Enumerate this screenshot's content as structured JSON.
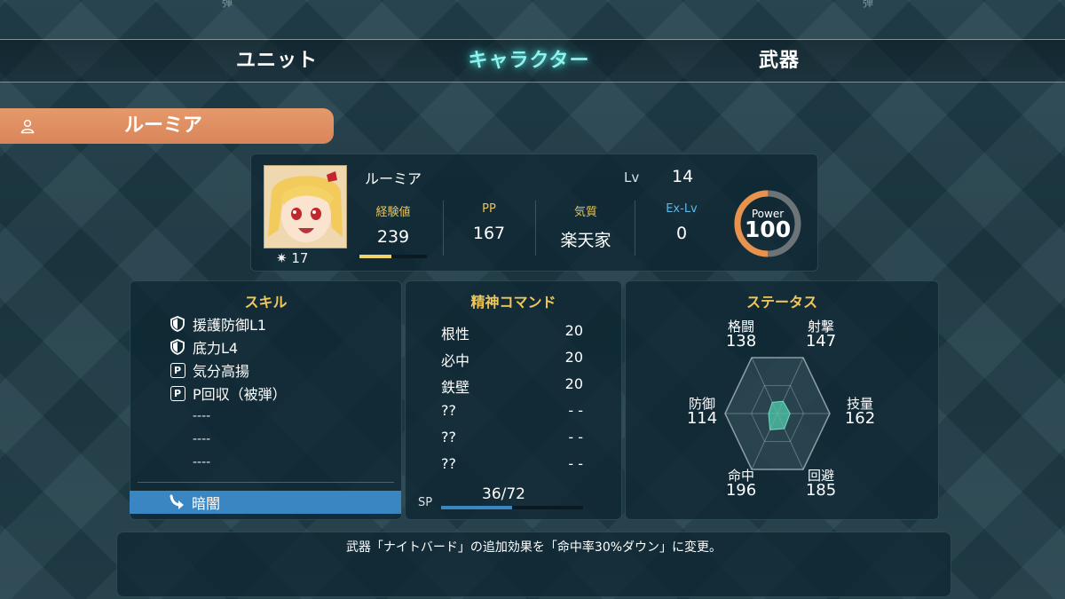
{
  "top_marks": [
    "弾",
    "弾"
  ],
  "tabs": [
    {
      "label": "ユニット",
      "active": false
    },
    {
      "label": "キャラクター",
      "active": true
    },
    {
      "label": "武器",
      "active": false
    }
  ],
  "character": {
    "banner_name": "ルーミア",
    "name": "ルーミア",
    "level_label": "Lv",
    "level": "14",
    "stars": "✷ 17",
    "stats": [
      {
        "label": "経験値",
        "value": "239"
      },
      {
        "label": "PP",
        "value": "167"
      },
      {
        "label": "気質",
        "value": "楽天家"
      },
      {
        "label": "Ex-Lv",
        "value": "0"
      }
    ],
    "exp_progress": 0.48,
    "power_label": "Power",
    "power_value": "100",
    "power_progress": 0.5
  },
  "skills": {
    "title": "スキル",
    "items": [
      {
        "label": "援護防御L1",
        "icon": "shield-icon"
      },
      {
        "label": "底力L4",
        "icon": "shield-icon"
      },
      {
        "label": "気分高揚",
        "icon": "p-badge-icon"
      },
      {
        "label": "P回収（被弾）",
        "icon": "p-badge-icon"
      },
      {
        "label": "----",
        "icon": ""
      },
      {
        "label": "----",
        "icon": ""
      },
      {
        "label": "----",
        "icon": ""
      }
    ],
    "special": {
      "label": "暗闇",
      "icon": "arrow-down-right-icon"
    }
  },
  "mind": {
    "title": "精神コマンド",
    "commands": [
      {
        "name": "根性",
        "cost": "20"
      },
      {
        "name": "必中",
        "cost": "20"
      },
      {
        "name": "鉄壁",
        "cost": "20"
      },
      {
        "name": "??",
        "cost": "- -"
      },
      {
        "name": "??",
        "cost": "- -"
      },
      {
        "name": "??",
        "cost": "- -"
      }
    ],
    "sp_label": "SP",
    "sp_value": "36/72",
    "sp_progress": 0.5
  },
  "status": {
    "title": "ステータス",
    "stats": [
      {
        "label": "格闘",
        "value": "138"
      },
      {
        "label": "射撃",
        "value": "147"
      },
      {
        "label": "技量",
        "value": "162"
      },
      {
        "label": "回避",
        "value": "185"
      },
      {
        "label": "命中",
        "value": "196"
      },
      {
        "label": "防御",
        "value": "114"
      }
    ],
    "radar_levels": [
      0.2,
      0.22,
      0.24,
      0.27,
      0.29,
      0.17
    ]
  },
  "description": "武器「ナイトバード」の追加効果を「命中率30%ダウン」に変更。"
}
